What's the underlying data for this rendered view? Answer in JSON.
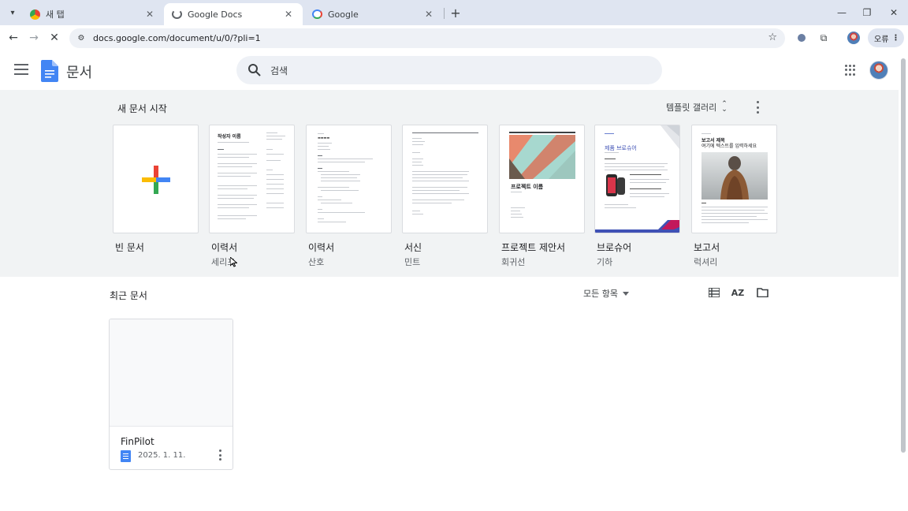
{
  "browser": {
    "tabs": [
      {
        "title": "새 탭",
        "favicon": "chrome-icon",
        "active": false
      },
      {
        "title": "Google Docs",
        "favicon": "loading-icon",
        "active": true
      },
      {
        "title": "Google",
        "favicon": "google-g-icon",
        "active": false
      }
    ],
    "url": "docs.google.com/document/u/0/?pli=1",
    "profile_label": "오류"
  },
  "header": {
    "app_name": "문서",
    "search_placeholder": "검색"
  },
  "templates": {
    "section_title": "새 문서 시작",
    "gallery_label": "템플릿 갤러리",
    "items": [
      {
        "name": "빈 문서",
        "subtitle": ""
      },
      {
        "name": "이력서",
        "subtitle": "세리프"
      },
      {
        "name": "이력서",
        "subtitle": "산호"
      },
      {
        "name": "서신",
        "subtitle": "민트"
      },
      {
        "name": "프로젝트 제안서",
        "subtitle": "회귀선"
      },
      {
        "name": "브로슈어",
        "subtitle": "기하"
      },
      {
        "name": "보고서",
        "subtitle": "럭셔리"
      }
    ],
    "thumb_text": {
      "resume_name": "작성자 이름",
      "project_title": "프로젝트 이름",
      "brochure_title": "제품 브로슈어",
      "report_title": "보고서 제목",
      "report_subtitle": "여기에 텍스트를 입력하세요"
    }
  },
  "recent": {
    "title": "최근 문서",
    "filter_label": "모든 항목",
    "documents": [
      {
        "title": "FinPilot",
        "date": "2025. 1. 11."
      }
    ]
  },
  "colors": {
    "docs_blue": "#4285f4",
    "section_bg": "#f1f3f4",
    "tabstrip_bg": "#dfe5f1"
  }
}
